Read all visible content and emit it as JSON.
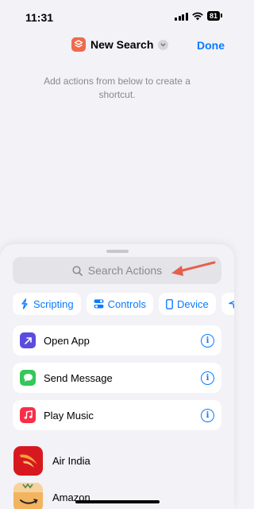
{
  "status_bar": {
    "time": "11:31",
    "battery": "81"
  },
  "nav": {
    "title": "New Search",
    "done_label": "Done"
  },
  "hint": "Add actions from below to create a shortcut.",
  "search": {
    "placeholder": "Search Actions"
  },
  "categories": [
    {
      "label": "Scripting",
      "icon": "scripting-icon"
    },
    {
      "label": "Controls",
      "icon": "controls-icon"
    },
    {
      "label": "Device",
      "icon": "device-icon"
    }
  ],
  "suggested_actions": [
    {
      "label": "Open App",
      "icon": "open-app-arrow-icon",
      "color": "#5b4ce0"
    },
    {
      "label": "Send Message",
      "icon": "message-bubble-icon",
      "color": "#34c759"
    },
    {
      "label": "Play Music",
      "icon": "music-note-icon",
      "color": "#fa2d48"
    }
  ],
  "apps": [
    {
      "label": "Air India",
      "icon": "air-india-logo-icon",
      "color": "#d7191f"
    },
    {
      "label": "Amazon",
      "icon": "amazon-logo-icon",
      "color": "#f3b35f"
    }
  ],
  "colors": {
    "accent": "#0a7aff",
    "app_icon": "#ee6a4d",
    "annotation_arrow": "#e5604a"
  }
}
